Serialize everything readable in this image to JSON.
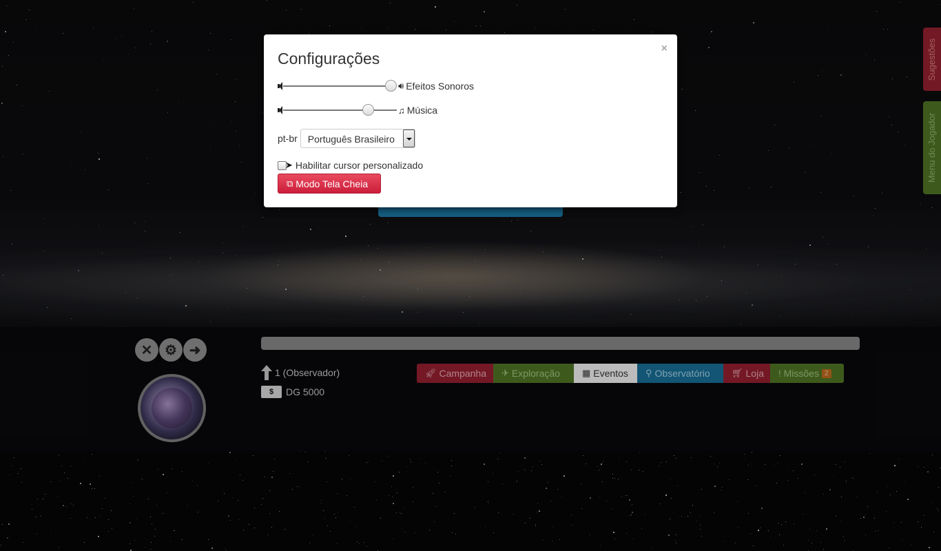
{
  "modal": {
    "title": "Configurações",
    "close": "×",
    "sound_effects": {
      "label": "Efeitos Sonoros",
      "level": 1.0,
      "icon": "volume-up-icon"
    },
    "music": {
      "label": "Música",
      "level": 0.78,
      "icon": "music-icon"
    },
    "language": {
      "code": "pt-br",
      "selected": "Português Brasileiro"
    },
    "custom_cursor": {
      "label": "Habilitar cursor personalizado",
      "checked": false
    },
    "fullscreen_button": "Modo Tela Cheia"
  },
  "side_tabs": {
    "suggestions": "Sugestões",
    "player_menu": "Menu do Jogador"
  },
  "player": {
    "level_text": "1 (Observador)",
    "money_text": "DG 5000",
    "bill_symbol": "$"
  },
  "nav": {
    "campanha": "Campanha",
    "exploracao": "Exploração",
    "eventos": "Eventos",
    "observatorio": "Observatório",
    "loja": "Loja",
    "missoes": "Missões",
    "missoes_badge": "2"
  },
  "colors": {
    "red": "#8e1e2f",
    "green": "#4b6e23",
    "blue": "#16688e",
    "button_red": "#cc1e3b"
  }
}
